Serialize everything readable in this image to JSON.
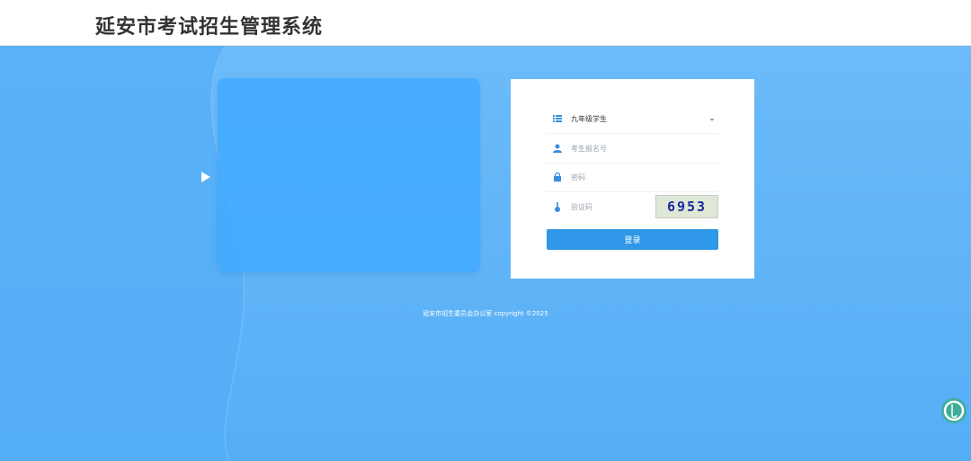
{
  "header": {
    "title": "延安市考试招生管理系统"
  },
  "video_panel": {
    "play_icon": "play-triangle-icon"
  },
  "login": {
    "user_type": {
      "selected": "九年级学生",
      "icon": "list-icon"
    },
    "exam_id": {
      "placeholder": "考生报名号",
      "icon": "user-icon"
    },
    "password": {
      "placeholder": "密码",
      "icon": "lock-icon"
    },
    "captcha": {
      "placeholder": "验证码",
      "icon": "key-icon",
      "code": "6953"
    },
    "submit_label": "登录"
  },
  "footer": {
    "text": "延安市招生委员会办公室 copyright ©2025"
  },
  "colors": {
    "accent": "#2f98e8",
    "background": "#5fb2f6",
    "captcha_text": "#1b2c9e"
  }
}
